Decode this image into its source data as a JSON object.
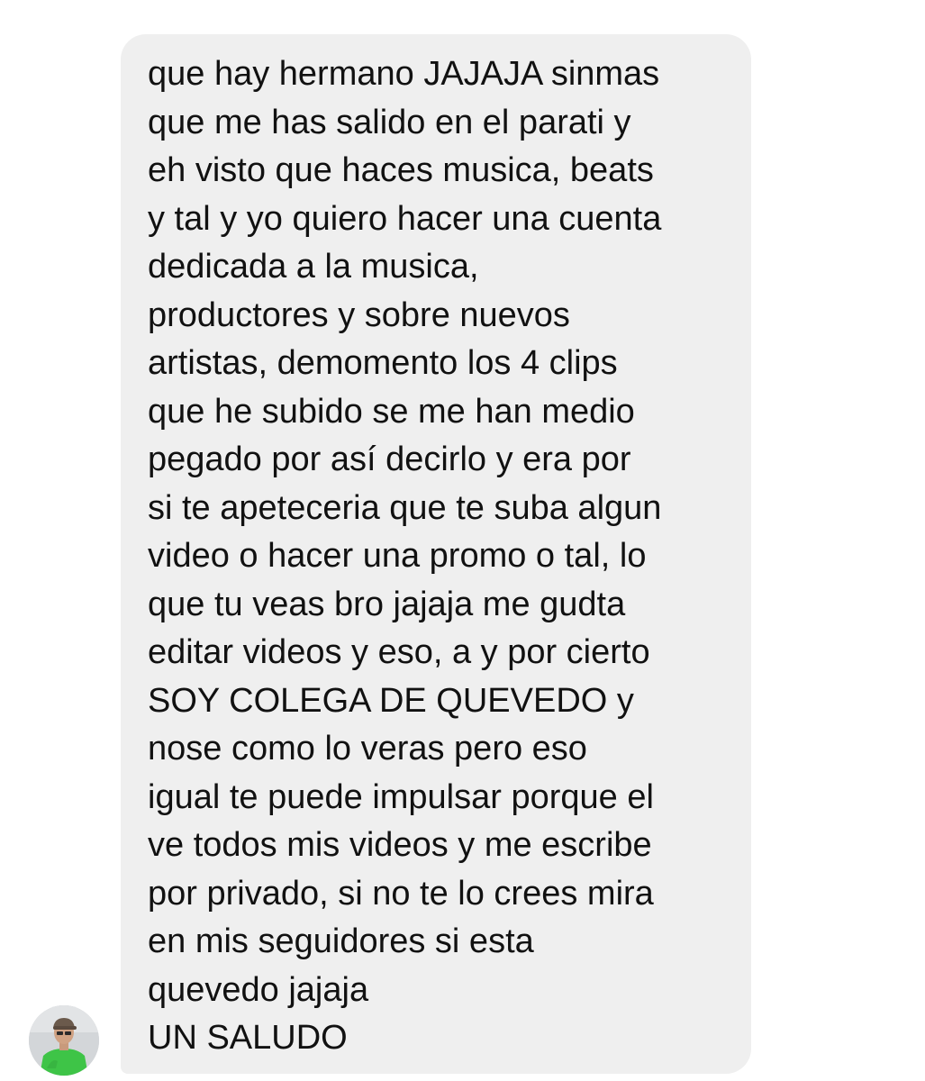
{
  "message": {
    "lines": [
      "que hay hermano JAJAJA sinmas",
      "que me has salido en el parati y",
      "eh visto que haces musica, beats",
      "y tal y yo quiero hacer una cuenta",
      "dedicada a la musica,",
      "productores y sobre nuevos",
      "artistas, demomento los 4 clips",
      "que he subido se me han medio",
      "pegado por así decirlo y era por",
      "si te apeteceria que te suba algun",
      "video o hacer una promo o tal, lo",
      "que tu veas bro jajaja me gudta",
      "editar videos y eso, a y por cierto",
      "SOY COLEGA DE QUEVEDO y",
      "nose como lo veras pero eso",
      "igual te puede impulsar porque el",
      "ve todos mis videos y me escribe",
      "por privado, si no te lo crees mira",
      "en mis seguidores si esta",
      "quevedo jajaja",
      "UN SALUDO"
    ]
  },
  "colors": {
    "bubble": "#efefef",
    "text": "#111111",
    "background": "#ffffff",
    "avatar_shirt": "#3ec447"
  },
  "avatar": {
    "icon": "user-avatar-photo"
  }
}
